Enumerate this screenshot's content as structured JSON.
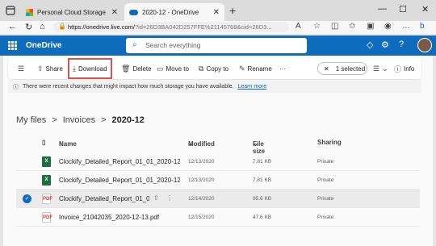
{
  "browser": {
    "tabs": [
      {
        "label": "Personal Cloud Storage – Micros",
        "close": "✕"
      },
      {
        "label": "2020-12 - OneDrive",
        "close": "✕"
      }
    ],
    "new_tab": "+",
    "window_controls": {
      "minimize": "—",
      "maximize": "☐",
      "close": "✕"
    },
    "url_host": "https://onedrive.live.com/",
    "url_rest": "?id=26D3BA042D257FFE%21145768&cid=26D3..."
  },
  "app": {
    "name": "OneDrive",
    "search_placeholder": "Search everything",
    "brand_color": "#0f6cbd"
  },
  "toolbar": {
    "share": "Share",
    "download": "Download",
    "delete": "Delete",
    "move_to": "Move to",
    "copy_to": "Copy to",
    "rename": "Rename",
    "more": "···",
    "selected": "1 selected",
    "info": "Info"
  },
  "notice": {
    "text": "There were recent changes that might impact how much storage you have available.",
    "link": "Learn more"
  },
  "breadcrumb": {
    "items": [
      "My files",
      "Invoices",
      "2020-12"
    ],
    "separator": ">"
  },
  "table": {
    "headers": {
      "name": "Name",
      "modified": "Modified",
      "size": "File size",
      "sharing": "Sharing"
    },
    "rows": [
      {
        "name": "Clockify_Detailed_Report_01_01_2020-12_3...",
        "modified": "12/13/2020",
        "size": "7.81 KB",
        "sharing": "Private",
        "type": "xlsx",
        "badge": "X"
      },
      {
        "name": "Clockify_Detailed_Report_01_01_2020-12_3...",
        "modified": "12/13/2020",
        "size": "7.81 KB",
        "sharing": "Private",
        "type": "xlsx",
        "badge": "X"
      },
      {
        "name": "Clockify_Detailed_Report_01_0...",
        "modified": "12/14/2020",
        "size": "95.6 KB",
        "sharing": "Private",
        "type": "pdf",
        "badge": "PDF",
        "selected": true
      },
      {
        "name": "Invoice_21042035_2020-12-13.pdf",
        "modified": "12/15/2020",
        "size": "47.6 KB",
        "sharing": "Private",
        "type": "pdf",
        "badge": "PDF"
      }
    ]
  }
}
